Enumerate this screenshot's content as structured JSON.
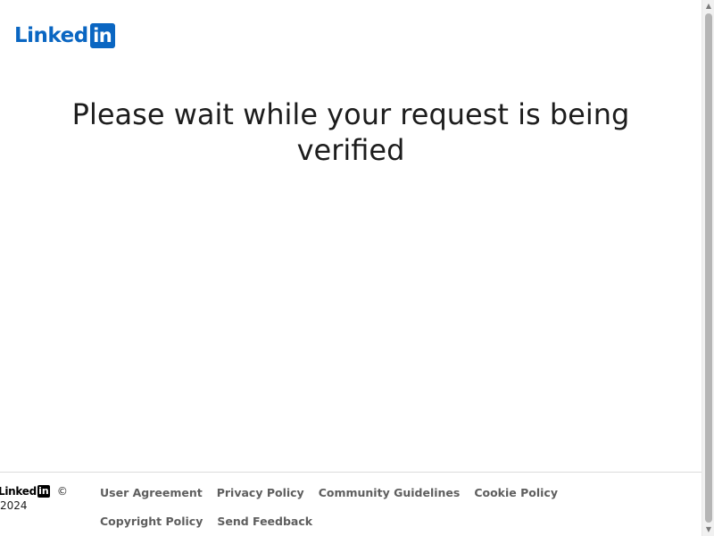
{
  "header": {
    "logo_word": "Linked",
    "logo_box": "in"
  },
  "main": {
    "heading": "Please wait while your request is being verified"
  },
  "footer": {
    "logo_word": "Linked",
    "logo_box": "in",
    "copyright": "© 2024",
    "links": [
      "User Agreement",
      "Privacy Policy",
      "Community Guidelines",
      "Cookie Policy",
      "Copyright Policy",
      "Send Feedback"
    ]
  },
  "scrollbar": {
    "up_icon": "▲",
    "down_icon": "▼"
  },
  "colors": {
    "brand": "#0a66c2",
    "footer_link": "#5e5e5e"
  }
}
